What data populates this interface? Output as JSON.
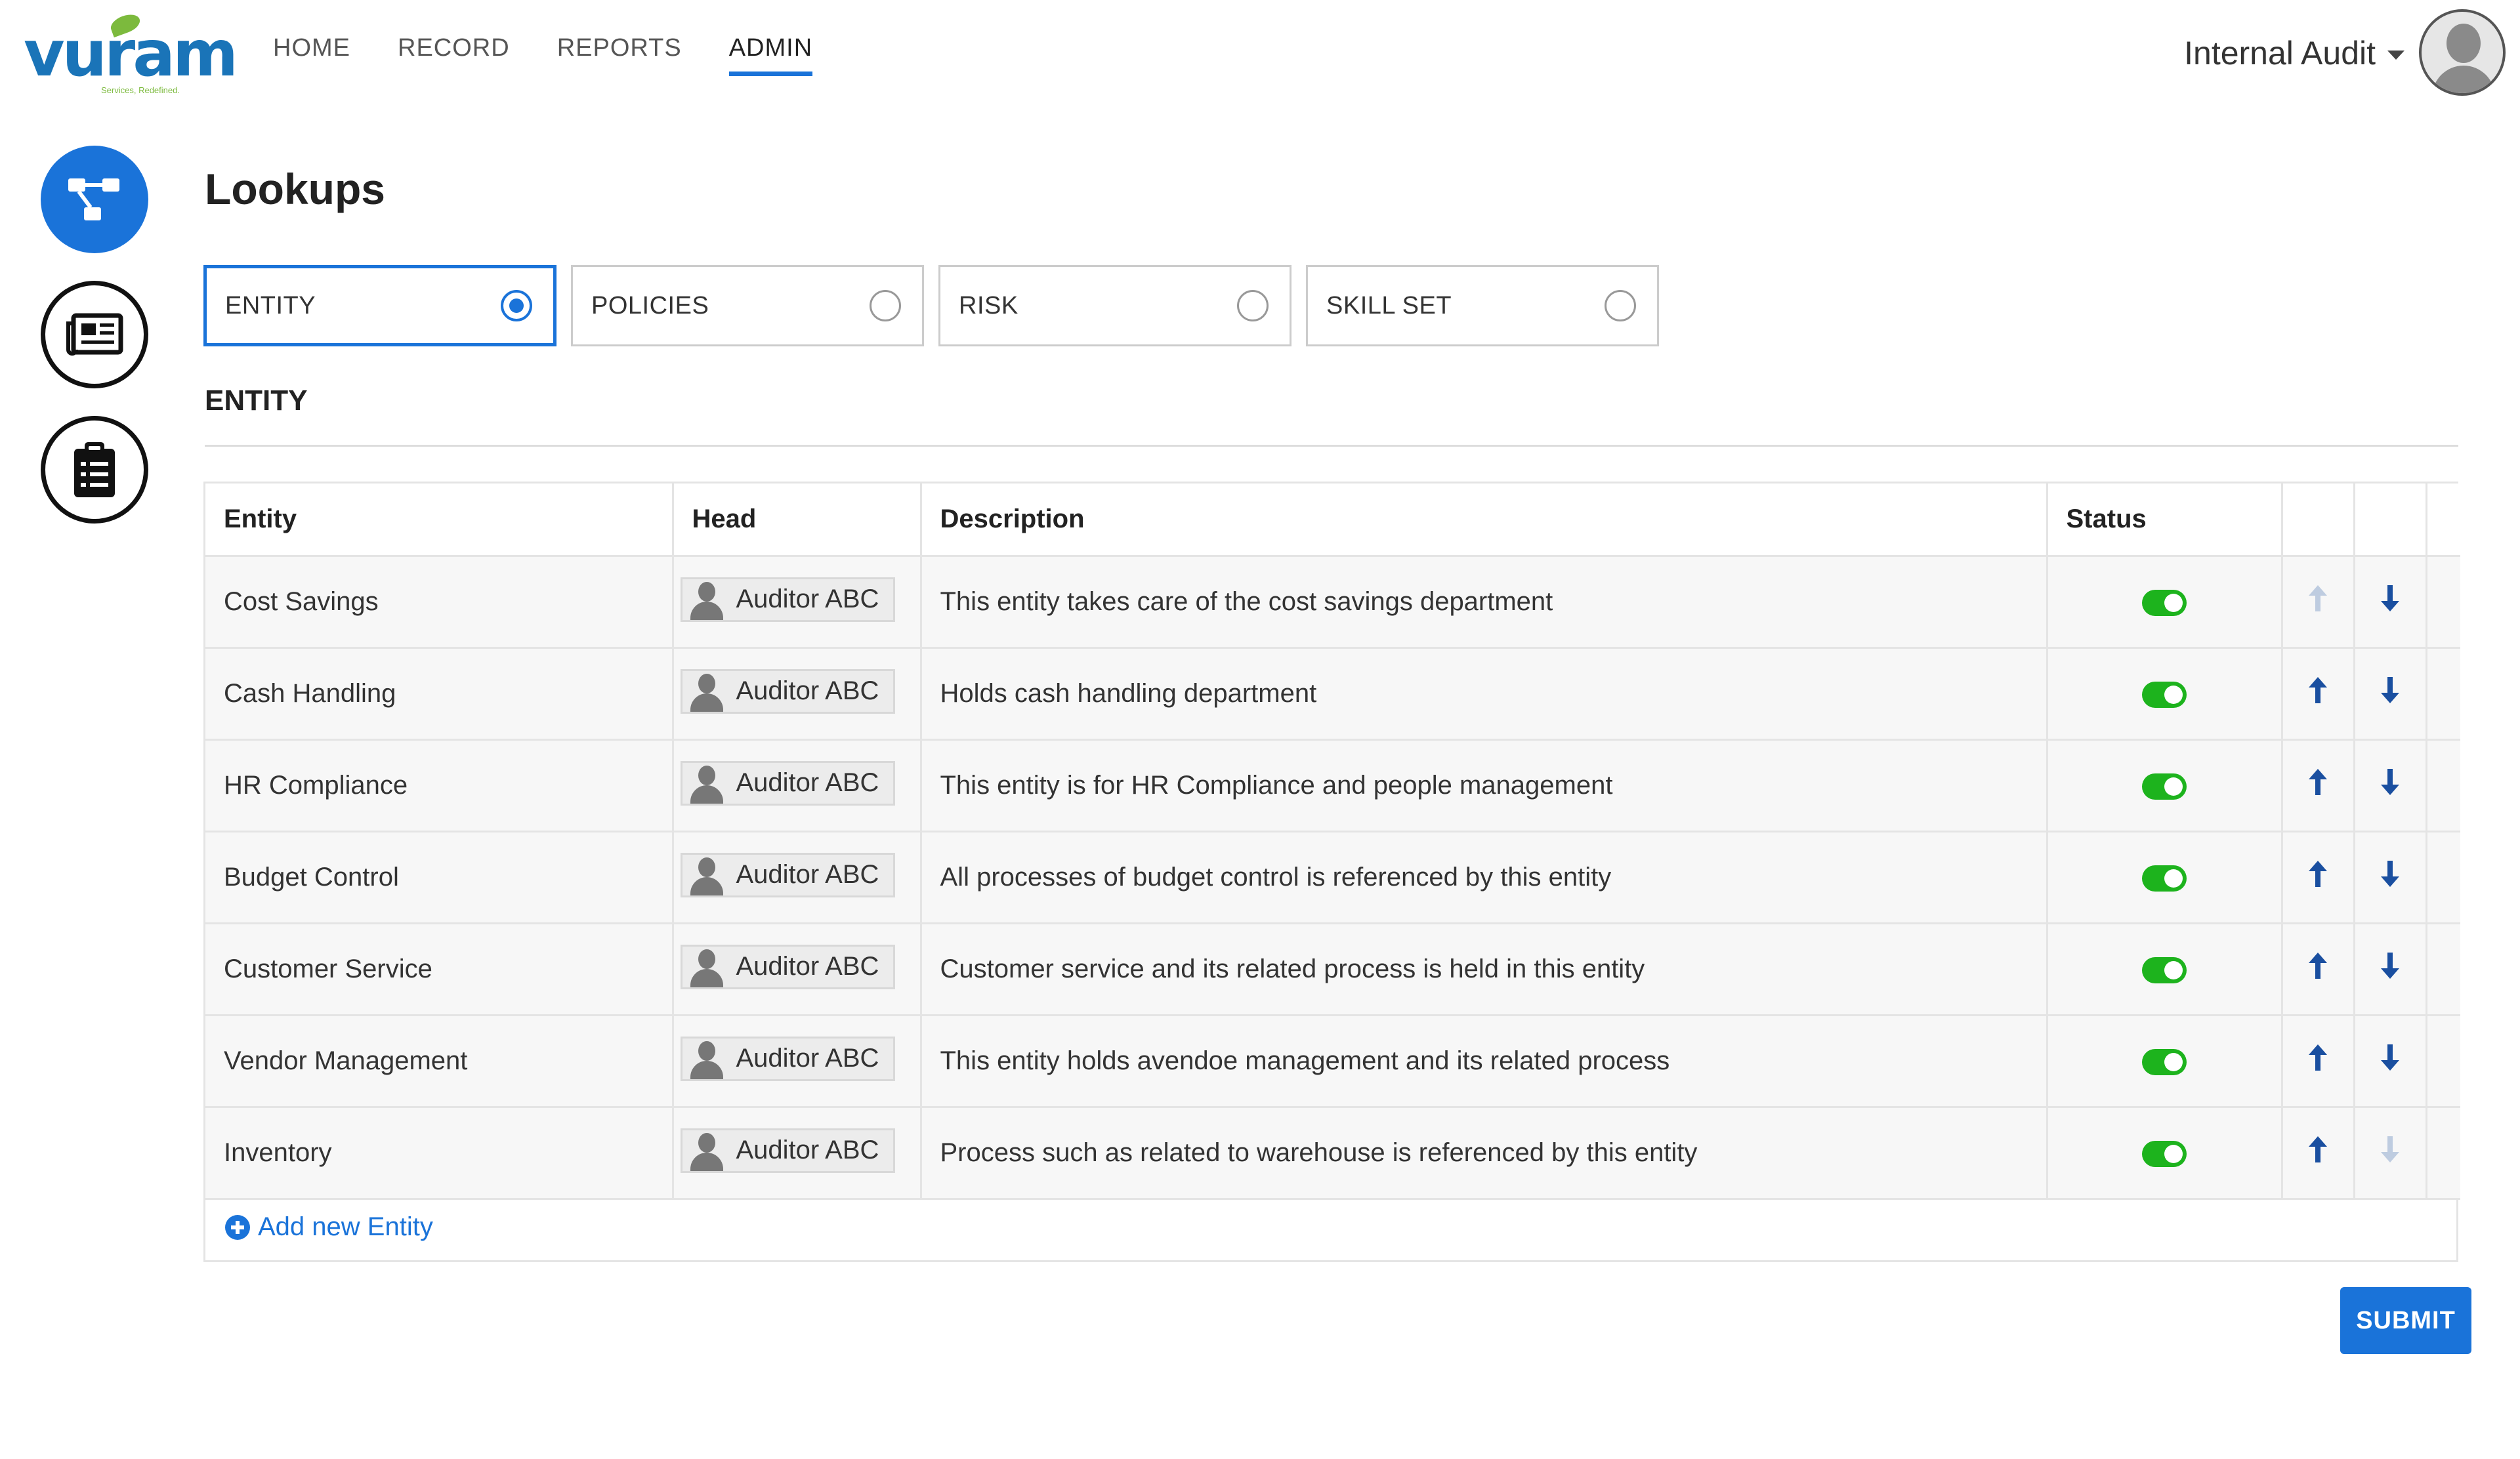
{
  "brand": {
    "logo_text": "vuram",
    "tagline": "Services, Redefined."
  },
  "nav": {
    "items": [
      {
        "label": "HOME"
      },
      {
        "label": "RECORD"
      },
      {
        "label": "REPORTS"
      },
      {
        "label": "ADMIN",
        "active": true
      }
    ]
  },
  "header": {
    "org_label": "Internal Audit"
  },
  "rail": {
    "items": [
      {
        "icon": "hierarchy-icon",
        "active": true
      },
      {
        "icon": "newspaper-icon",
        "active": false
      },
      {
        "icon": "clipboard-icon",
        "active": false
      }
    ]
  },
  "page": {
    "title": "Lookups"
  },
  "tabs": [
    {
      "label": "ENTITY",
      "selected": true
    },
    {
      "label": "POLICIES",
      "selected": false
    },
    {
      "label": "RISK",
      "selected": false
    },
    {
      "label": "SKILL SET",
      "selected": false
    }
  ],
  "section": {
    "title": "ENTITY"
  },
  "table": {
    "headers": [
      "Entity",
      "Head",
      "Description",
      "Status",
      "",
      ""
    ],
    "rows": [
      {
        "entity": "Cost Savings",
        "head": "Auditor ABC",
        "description": "This entity takes care of the cost savings department",
        "status": "on",
        "up_enabled": false,
        "down_enabled": true
      },
      {
        "entity": "Cash Handling",
        "head": "Auditor ABC",
        "description": "Holds cash handling department",
        "status": "on",
        "up_enabled": true,
        "down_enabled": true
      },
      {
        "entity": "HR Compliance",
        "head": "Auditor ABC",
        "description": "This entity is for HR Compliance and people management",
        "status": "on",
        "up_enabled": true,
        "down_enabled": true
      },
      {
        "entity": "Budget Control",
        "head": "Auditor ABC",
        "description": "All processes of budget control is referenced by this entity",
        "status": "on",
        "up_enabled": true,
        "down_enabled": true
      },
      {
        "entity": "Customer Service",
        "head": "Auditor ABC",
        "description": "Customer service and its related process is held in this entity",
        "status": "on",
        "up_enabled": true,
        "down_enabled": true
      },
      {
        "entity": "Vendor Management",
        "head": "Auditor ABC",
        "description": "This entity holds avendoe management and its related process",
        "status": "on",
        "up_enabled": true,
        "down_enabled": true
      },
      {
        "entity": "Inventory",
        "head": "Auditor ABC",
        "description": "Process such as related to warehouse is referenced by this entity",
        "status": "on",
        "up_enabled": true,
        "down_enabled": false
      }
    ],
    "add_label": "Add new Entity"
  },
  "actions": {
    "submit_label": "SUBMIT"
  },
  "colors": {
    "accent": "#1a73d9",
    "toggle_on": "#1db31d",
    "arrow": "#1a4fa0",
    "logo_blue": "#1a74b8",
    "logo_green": "#7cba3d"
  }
}
